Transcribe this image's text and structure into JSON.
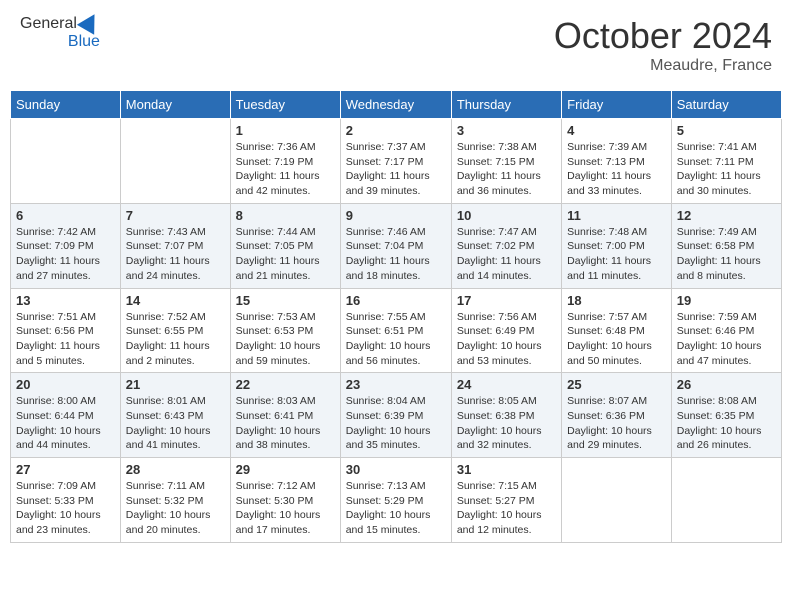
{
  "header": {
    "logo_general": "General",
    "logo_blue": "Blue",
    "month_title": "October 2024",
    "location": "Meaudre, France"
  },
  "days_of_week": [
    "Sunday",
    "Monday",
    "Tuesday",
    "Wednesday",
    "Thursday",
    "Friday",
    "Saturday"
  ],
  "weeks": [
    [
      {
        "day": "",
        "info": ""
      },
      {
        "day": "",
        "info": ""
      },
      {
        "day": "1",
        "info": "Sunrise: 7:36 AM\nSunset: 7:19 PM\nDaylight: 11 hours and 42 minutes."
      },
      {
        "day": "2",
        "info": "Sunrise: 7:37 AM\nSunset: 7:17 PM\nDaylight: 11 hours and 39 minutes."
      },
      {
        "day": "3",
        "info": "Sunrise: 7:38 AM\nSunset: 7:15 PM\nDaylight: 11 hours and 36 minutes."
      },
      {
        "day": "4",
        "info": "Sunrise: 7:39 AM\nSunset: 7:13 PM\nDaylight: 11 hours and 33 minutes."
      },
      {
        "day": "5",
        "info": "Sunrise: 7:41 AM\nSunset: 7:11 PM\nDaylight: 11 hours and 30 minutes."
      }
    ],
    [
      {
        "day": "6",
        "info": "Sunrise: 7:42 AM\nSunset: 7:09 PM\nDaylight: 11 hours and 27 minutes."
      },
      {
        "day": "7",
        "info": "Sunrise: 7:43 AM\nSunset: 7:07 PM\nDaylight: 11 hours and 24 minutes."
      },
      {
        "day": "8",
        "info": "Sunrise: 7:44 AM\nSunset: 7:05 PM\nDaylight: 11 hours and 21 minutes."
      },
      {
        "day": "9",
        "info": "Sunrise: 7:46 AM\nSunset: 7:04 PM\nDaylight: 11 hours and 18 minutes."
      },
      {
        "day": "10",
        "info": "Sunrise: 7:47 AM\nSunset: 7:02 PM\nDaylight: 11 hours and 14 minutes."
      },
      {
        "day": "11",
        "info": "Sunrise: 7:48 AM\nSunset: 7:00 PM\nDaylight: 11 hours and 11 minutes."
      },
      {
        "day": "12",
        "info": "Sunrise: 7:49 AM\nSunset: 6:58 PM\nDaylight: 11 hours and 8 minutes."
      }
    ],
    [
      {
        "day": "13",
        "info": "Sunrise: 7:51 AM\nSunset: 6:56 PM\nDaylight: 11 hours and 5 minutes."
      },
      {
        "day": "14",
        "info": "Sunrise: 7:52 AM\nSunset: 6:55 PM\nDaylight: 11 hours and 2 minutes."
      },
      {
        "day": "15",
        "info": "Sunrise: 7:53 AM\nSunset: 6:53 PM\nDaylight: 10 hours and 59 minutes."
      },
      {
        "day": "16",
        "info": "Sunrise: 7:55 AM\nSunset: 6:51 PM\nDaylight: 10 hours and 56 minutes."
      },
      {
        "day": "17",
        "info": "Sunrise: 7:56 AM\nSunset: 6:49 PM\nDaylight: 10 hours and 53 minutes."
      },
      {
        "day": "18",
        "info": "Sunrise: 7:57 AM\nSunset: 6:48 PM\nDaylight: 10 hours and 50 minutes."
      },
      {
        "day": "19",
        "info": "Sunrise: 7:59 AM\nSunset: 6:46 PM\nDaylight: 10 hours and 47 minutes."
      }
    ],
    [
      {
        "day": "20",
        "info": "Sunrise: 8:00 AM\nSunset: 6:44 PM\nDaylight: 10 hours and 44 minutes."
      },
      {
        "day": "21",
        "info": "Sunrise: 8:01 AM\nSunset: 6:43 PM\nDaylight: 10 hours and 41 minutes."
      },
      {
        "day": "22",
        "info": "Sunrise: 8:03 AM\nSunset: 6:41 PM\nDaylight: 10 hours and 38 minutes."
      },
      {
        "day": "23",
        "info": "Sunrise: 8:04 AM\nSunset: 6:39 PM\nDaylight: 10 hours and 35 minutes."
      },
      {
        "day": "24",
        "info": "Sunrise: 8:05 AM\nSunset: 6:38 PM\nDaylight: 10 hours and 32 minutes."
      },
      {
        "day": "25",
        "info": "Sunrise: 8:07 AM\nSunset: 6:36 PM\nDaylight: 10 hours and 29 minutes."
      },
      {
        "day": "26",
        "info": "Sunrise: 8:08 AM\nSunset: 6:35 PM\nDaylight: 10 hours and 26 minutes."
      }
    ],
    [
      {
        "day": "27",
        "info": "Sunrise: 7:09 AM\nSunset: 5:33 PM\nDaylight: 10 hours and 23 minutes."
      },
      {
        "day": "28",
        "info": "Sunrise: 7:11 AM\nSunset: 5:32 PM\nDaylight: 10 hours and 20 minutes."
      },
      {
        "day": "29",
        "info": "Sunrise: 7:12 AM\nSunset: 5:30 PM\nDaylight: 10 hours and 17 minutes."
      },
      {
        "day": "30",
        "info": "Sunrise: 7:13 AM\nSunset: 5:29 PM\nDaylight: 10 hours and 15 minutes."
      },
      {
        "day": "31",
        "info": "Sunrise: 7:15 AM\nSunset: 5:27 PM\nDaylight: 10 hours and 12 minutes."
      },
      {
        "day": "",
        "info": ""
      },
      {
        "day": "",
        "info": ""
      }
    ]
  ]
}
